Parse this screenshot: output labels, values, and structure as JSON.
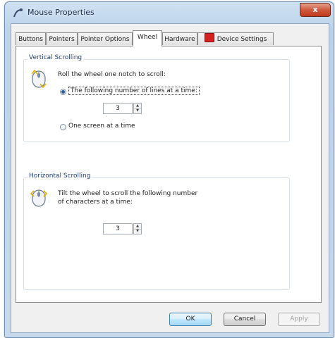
{
  "window": {
    "title": "Mouse Properties",
    "close_label": "x"
  },
  "tabs": [
    {
      "label": "Buttons"
    },
    {
      "label": "Pointers"
    },
    {
      "label": "Pointer Options"
    },
    {
      "label": "Wheel"
    },
    {
      "label": "Hardware"
    },
    {
      "label": "Device Settings"
    }
  ],
  "active_tab": "Wheel",
  "vertical_scrolling": {
    "title": "Vertical Scrolling",
    "instruction": "Roll the wheel one notch to scroll:",
    "option_lines": "The following number of lines at a time:",
    "lines_value": "3",
    "option_screen": "One screen at a time",
    "selected": "lines"
  },
  "horizontal_scrolling": {
    "title": "Horizontal Scrolling",
    "instruction_line1": "Tilt the wheel to scroll the following number",
    "instruction_line2": "of characters at a time:",
    "chars_value": "3"
  },
  "buttons": {
    "ok": "OK",
    "cancel": "Cancel",
    "apply": "Apply"
  },
  "icons": {
    "title": "mouse-properties-icon",
    "wheel": "mouse-wheel-icon",
    "device_settings": "device-settings-icon"
  }
}
